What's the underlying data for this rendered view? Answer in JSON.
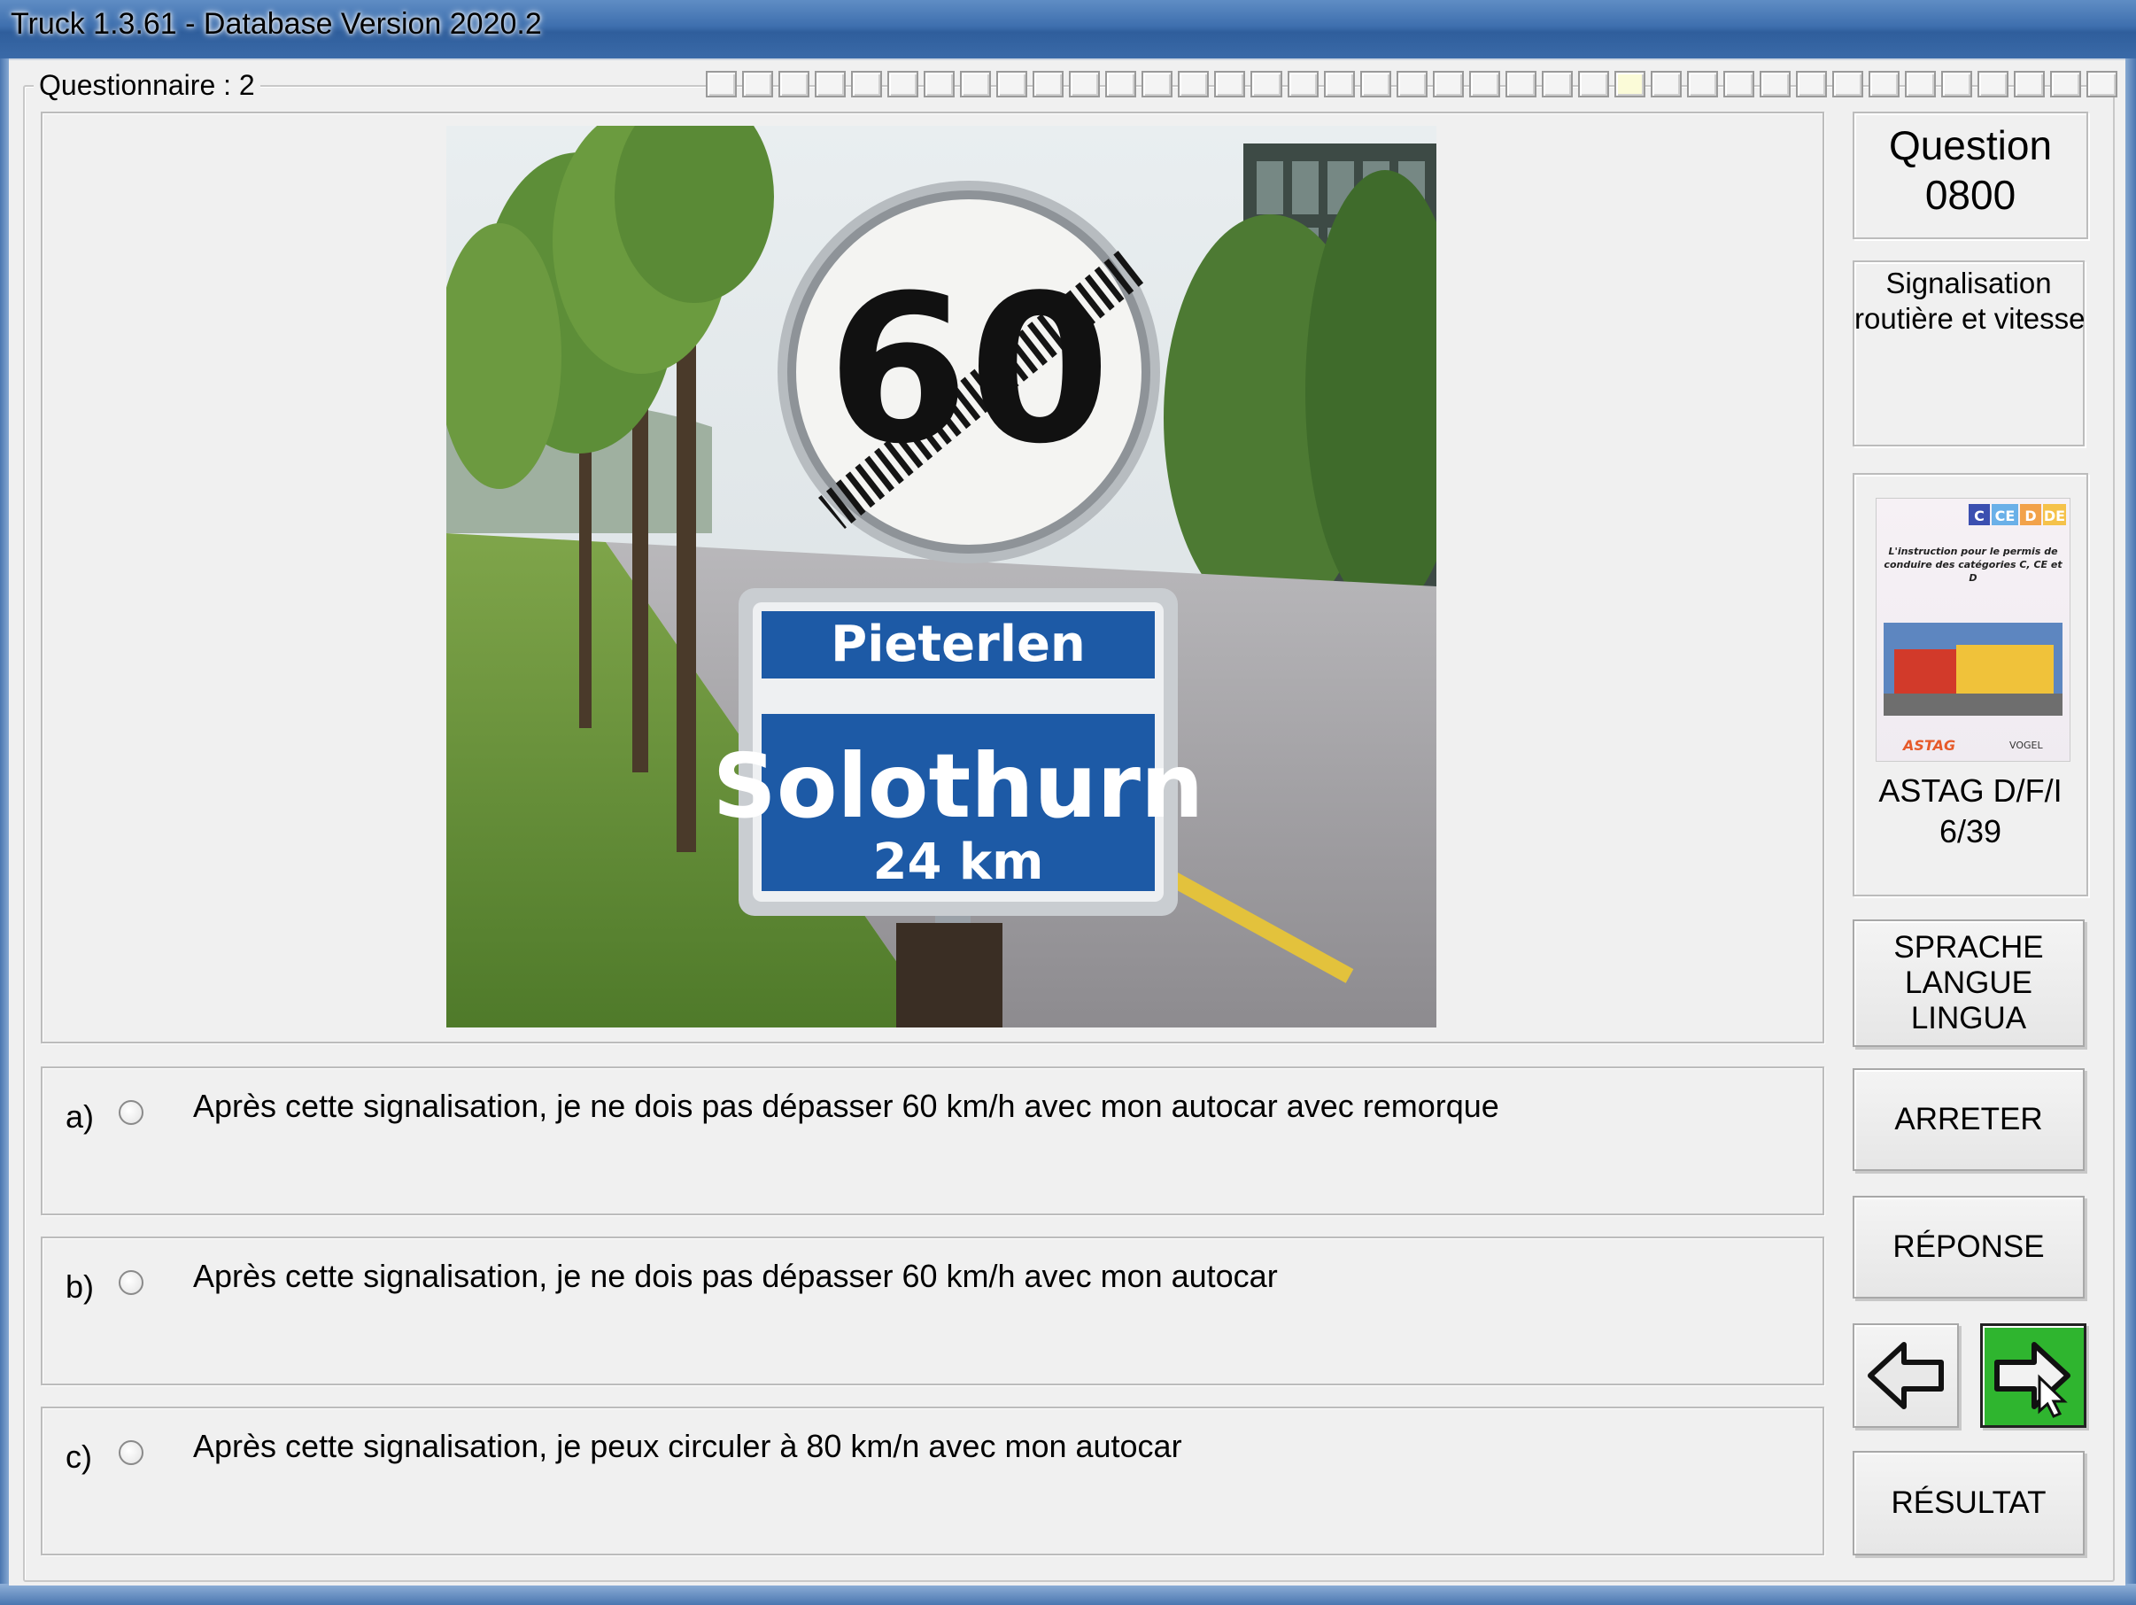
{
  "window": {
    "title": "Truck 1.3.61 - Database Version 2020.2"
  },
  "group": {
    "label": "Questionnaire : 2",
    "progress_total": 39,
    "progress_current": 26
  },
  "question": {
    "label": "Question",
    "number": "0800"
  },
  "category": {
    "line1": "Signalisation",
    "line2": "routière et vitesse"
  },
  "photo": {
    "sign_speed": "60",
    "place_sign_top": "Pieterlen",
    "place_sign_main": "Solothurn",
    "place_sign_distance": "24 km"
  },
  "book": {
    "badges": [
      "C",
      "CE",
      "D",
      "DE"
    ],
    "cover_title": "L'instruction pour le permis de conduire des catégories C, CE et D",
    "publisher_left": "ASTAG",
    "publisher_right": "VOGEL",
    "source_line1": "ASTAG D/F/I",
    "source_line2": "6/39"
  },
  "answers": [
    {
      "letter": "a)",
      "text": "Après cette signalisation, je ne dois pas dépasser 60 km/h avec mon autocar avec remorque"
    },
    {
      "letter": "b)",
      "text": "Après cette signalisation, je ne dois pas dépasser 60 km/h avec mon autocar"
    },
    {
      "letter": "c)",
      "text": "Après cette signalisation, je peux circuler à 80 km/n avec mon autocar"
    }
  ],
  "buttons": {
    "language": [
      "SPRACHE",
      "LANGUE",
      "LINGUA"
    ],
    "stop": "ARRETER",
    "answer": "RÉPONSE",
    "result": "RÉSULTAT"
  },
  "colors": {
    "next_button": "#2fb52f",
    "sign_blue": "#1d5aa6"
  }
}
